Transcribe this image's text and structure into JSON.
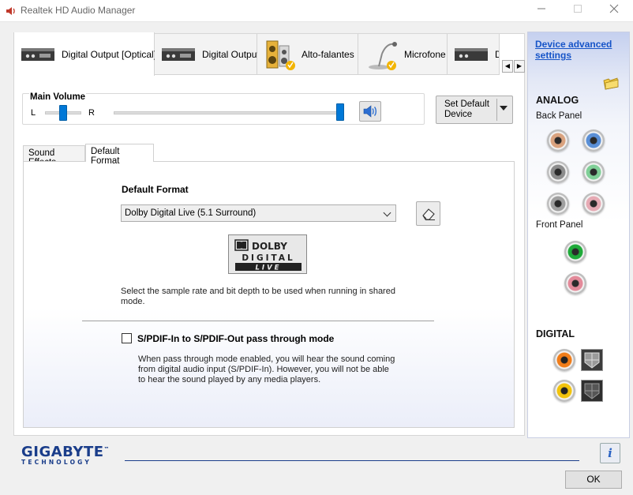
{
  "window": {
    "title": "Realtek HD Audio Manager",
    "icon": "speaker-icon",
    "controls": [
      "minimize",
      "maximize",
      "close"
    ]
  },
  "device_tabs": [
    {
      "label": "Digital Output [Optical]",
      "icon": "digital-device-icon",
      "active": true
    },
    {
      "label": "Digital Output",
      "icon": "digital-device-icon",
      "active": false
    },
    {
      "label": "Alto-falantes",
      "icon": "speakers-icon",
      "active": false
    },
    {
      "label": "Microfone",
      "icon": "microphone-icon",
      "active": false
    },
    {
      "label": "D",
      "icon": "digital-device-icon",
      "active": false
    }
  ],
  "volume": {
    "title": "Main Volume",
    "left_label": "L",
    "right_label": "R",
    "balance": 0.5,
    "level": 1.0
  },
  "set_default": {
    "label": "Set Default Device"
  },
  "inner_tabs": [
    {
      "label": "Sound Effects",
      "active": false
    },
    {
      "label": "Default Format",
      "active": true
    }
  ],
  "default_format": {
    "title": "Default Format",
    "selected": "Dolby Digital Live (5.1 Surround)",
    "logo_text": [
      "DOLBY",
      "DIGITAL",
      "LIVE"
    ],
    "description": "Select the sample rate and bit depth to be used when running in shared mode."
  },
  "passthrough": {
    "label": "S/PDIF-In to S/PDIF-Out pass through mode",
    "checked": false,
    "description": "When pass through mode enabled, you will hear the sound coming from digital audio input (S/PDIF-In). However, you will not be able to hear the sound played by any media players."
  },
  "sidebar": {
    "advanced_link": "Device advanced settings",
    "analog_heading": "ANALOG",
    "back_panel": "Back Panel",
    "front_panel": "Front Panel",
    "digital_heading": "DIGITAL",
    "back_jacks": [
      "#d9a27e",
      "#5a8fd6",
      "#8c8c8c",
      "#7fcf97",
      "#a0a0a0",
      "#e6aab4"
    ],
    "front_jacks": [
      "#1faa3a",
      "#e38a9a"
    ],
    "digital_jacks": [
      "#f07d1a",
      "#f2c30c"
    ]
  },
  "footer": {
    "brand": "GIGABYTE",
    "brand_sub": "TECHNOLOGY",
    "brand_tm": "™",
    "info_label": "i",
    "ok_label": "OK"
  },
  "colors": {
    "accent": "#0078d7",
    "link": "#1654c8",
    "brand": "#1a3d8a"
  }
}
